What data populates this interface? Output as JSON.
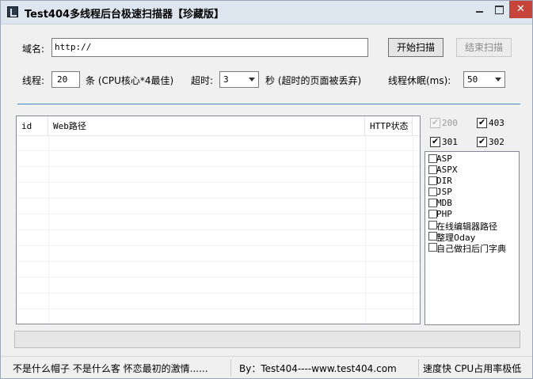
{
  "window": {
    "title": "Test404多线程后台极速扫描器【珍藏版】",
    "close_glyph": "✕"
  },
  "domain": {
    "label": "域名:",
    "value": "http://"
  },
  "buttons": {
    "start": "开始扫描",
    "stop": "结束扫描"
  },
  "threads": {
    "label": "线程:",
    "value": "20",
    "unit_note": "条 (CPU核心*4最佳)"
  },
  "timeout": {
    "label": "超时:",
    "value": "3",
    "unit_note": "秒 (超时的页面被丢弃)"
  },
  "sleep": {
    "label": "线程休眠(ms):",
    "value": "50"
  },
  "table": {
    "columns": [
      "id",
      "Web路径",
      "HTTP状态"
    ],
    "rows": []
  },
  "status_filters": [
    {
      "code": "200",
      "checked": true,
      "disabled": true
    },
    {
      "code": "403",
      "checked": true,
      "disabled": false
    },
    {
      "code": "301",
      "checked": true,
      "disabled": false
    },
    {
      "code": "302",
      "checked": true,
      "disabled": false
    }
  ],
  "dictionaries": [
    {
      "label": "ASP",
      "checked": false
    },
    {
      "label": "ASPX",
      "checked": false
    },
    {
      "label": "DIR",
      "checked": false
    },
    {
      "label": "JSP",
      "checked": false
    },
    {
      "label": "MDB",
      "checked": false
    },
    {
      "label": "PHP",
      "checked": false
    },
    {
      "label": "在线编辑器路径",
      "checked": false
    },
    {
      "label": "整理0day",
      "checked": false
    },
    {
      "label": "自己做扫后门字典",
      "checked": false
    }
  ],
  "progress": {
    "value": 0
  },
  "statusbar": {
    "left": "不是什么帽子 不是什么客 怀恋最初的激情......",
    "center": "By：Test404----www.test404.com",
    "right": "速度快 CPU占用率极低"
  },
  "colors": {
    "accent_divider": "#3e86c4",
    "close_button": "#c7443a",
    "titlebar": "#dde5ef"
  }
}
